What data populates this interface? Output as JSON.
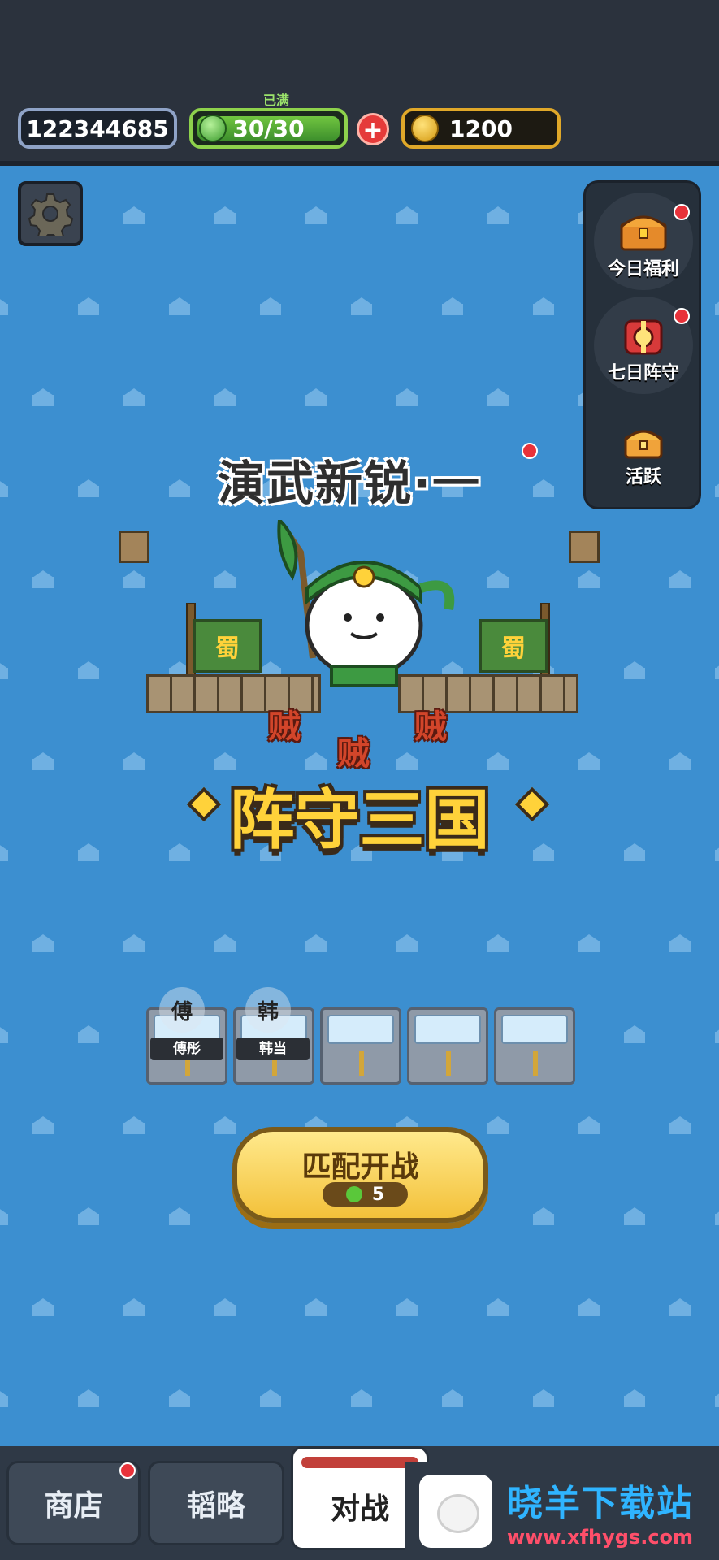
{
  "status": {
    "player_id": "122344685",
    "energy_label": "已满",
    "energy": "30/30",
    "add": "+",
    "gold": "1200"
  },
  "sidebar": {
    "items": [
      {
        "label": "今日福利",
        "icon": "treasure-chest-icon",
        "badge": true
      },
      {
        "label": "七日阵守",
        "icon": "gift-icon",
        "badge": true
      },
      {
        "label": "活跃",
        "icon": "chest-icon",
        "badge": false
      }
    ]
  },
  "stage": {
    "title": "演武新锐·一"
  },
  "logo": {
    "title": "阵守三国",
    "flag_text": "蜀",
    "bandit_text": "贼"
  },
  "lineup": {
    "heroes": [
      {
        "badge": "傅",
        "name": "傅彤"
      },
      {
        "badge": "韩",
        "name": "韩当"
      }
    ],
    "empty_slots": 3
  },
  "match": {
    "label": "匹配开战",
    "cost": "5"
  },
  "tabs": [
    {
      "label": "商店",
      "badge": true
    },
    {
      "label": "韬略",
      "badge": false
    },
    {
      "label": "对战",
      "active": true
    }
  ],
  "watermark": {
    "name": "晓羊下载站",
    "url": "www.xfhygs.com"
  },
  "colors": {
    "field": "#3c8fd0",
    "gold": "#ffd23a",
    "energy": "#8ed24c",
    "alert": "#e8323a"
  }
}
